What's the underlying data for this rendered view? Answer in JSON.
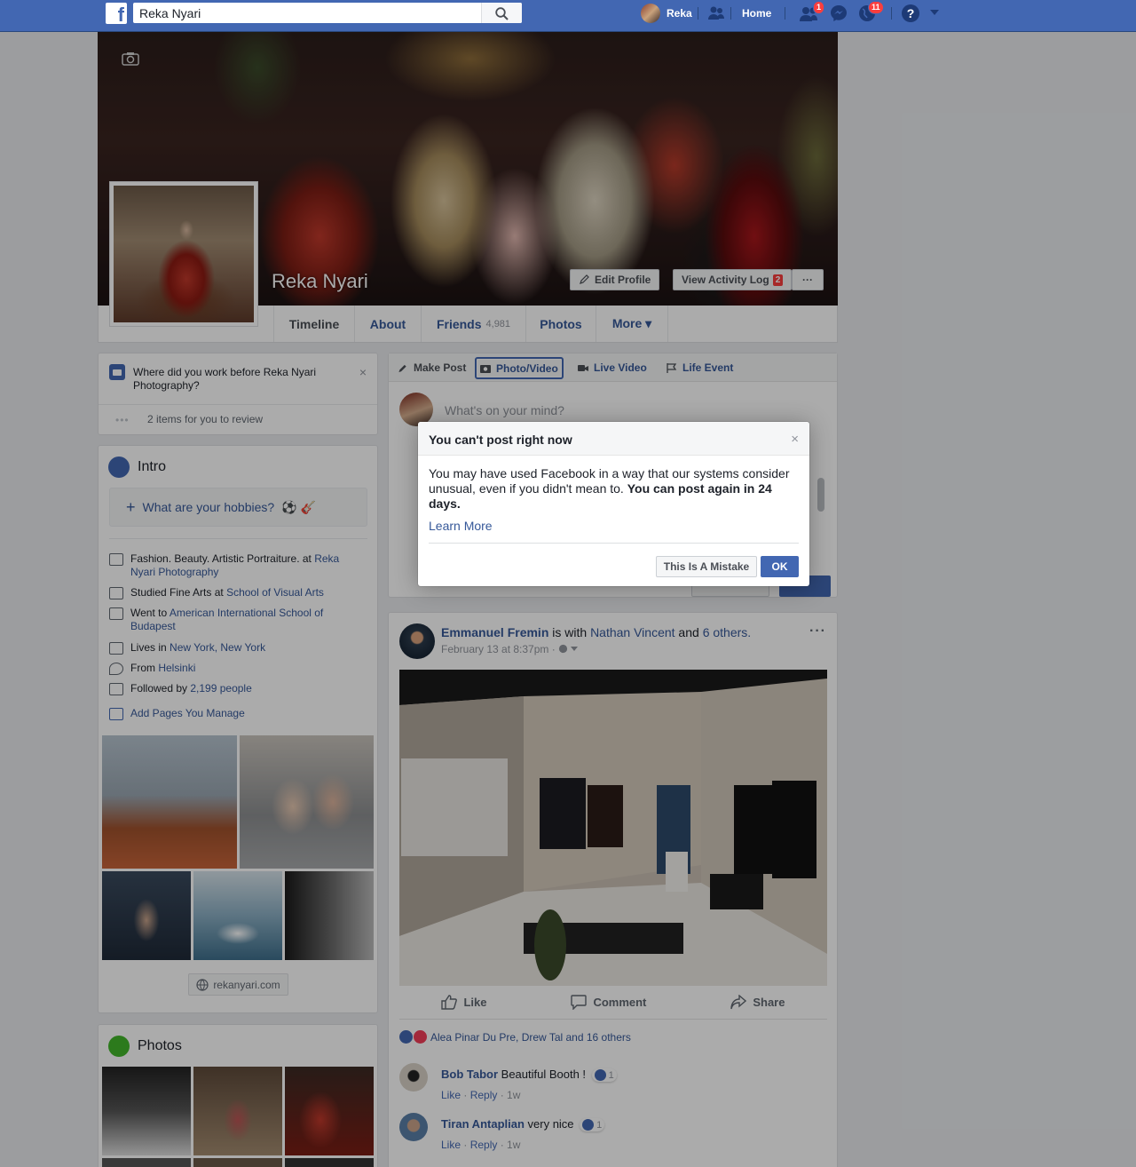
{
  "topbar": {
    "logo": "f",
    "search_value": "Reka Nyari",
    "user_name": "Reka",
    "home_label": "Home",
    "friend_requests_badge": "1",
    "notifications_badge": "11",
    "icons": [
      "search-icon",
      "friends-icon",
      "friend-requests-icon",
      "messenger-icon",
      "notifications-globe-icon",
      "help-icon",
      "account-menu-caret-icon"
    ]
  },
  "profile": {
    "name": "Reka Nyari",
    "edit_profile": "Edit Profile",
    "view_activity_log": "View Activity Log",
    "activity_badge": "2",
    "more_dots": "···"
  },
  "tabs": [
    {
      "label": "Timeline"
    },
    {
      "label": "About"
    },
    {
      "label": "Friends",
      "count": "4,981"
    },
    {
      "label": "Photos"
    },
    {
      "label": "More ▾"
    }
  ],
  "question_card": {
    "text": "Where did you work before Reka Nyari Photography?",
    "review": "2 items for you to review",
    "dots": "•••",
    "close": "×"
  },
  "intro": {
    "title": "Intro",
    "hobbies_prompt": "What are your hobbies?",
    "hobby_emojis": "⚽ 🎸",
    "items": [
      {
        "pre": "Fashion. Beauty. Artistic Portraiture. at ",
        "link": "Reka Nyari Photography",
        "icon": "work-icon"
      },
      {
        "pre": "Studied Fine Arts at ",
        "link": "School of Visual Arts",
        "icon": "education-icon"
      },
      {
        "pre": "Went to ",
        "link": "American International School of Budapest",
        "icon": "school-icon"
      },
      {
        "pre": "Lives in ",
        "link": "New York, New York",
        "icon": "home-icon"
      },
      {
        "pre": "From ",
        "link": "Helsinki",
        "icon": "location-pin-icon"
      },
      {
        "pre": "Followed by ",
        "link": "2,199 people",
        "icon": "followers-icon"
      }
    ],
    "add_pages": "Add Pages You Manage",
    "website": "rekanyari.com"
  },
  "photos_card": {
    "title": "Photos"
  },
  "composer": {
    "tabs": [
      "Make Post",
      "Photo/Video",
      "Live Video",
      "Life Event"
    ],
    "placeholder": "What's on your mind?"
  },
  "modal": {
    "title": "You can't post right now",
    "body_plain": "You may have used Facebook in a way that our systems consider unusual, even if you didn't mean to. ",
    "body_bold": "You can post again in 24 days.",
    "learn_more": "Learn More",
    "mistake_button": "This Is A Mistake",
    "ok_button": "OK",
    "close": "×"
  },
  "post": {
    "author": "Emmanuel Fremin",
    "with_text": " is with ",
    "tagged": "Nathan Vincent",
    "and_text": " and ",
    "others": "6 others.",
    "timestamp": "February 13 at 8:37pm · ",
    "more": "···",
    "like": "Like",
    "comment": "Comment",
    "share": "Share",
    "reactions_text": "Alea Pinar Du Pre, Drew Tal and 16 others",
    "comments": [
      {
        "name": "Bob Tabor",
        "text": " Beautiful Booth !",
        "reactions": "1",
        "like": "Like",
        "reply": "Reply",
        "time": " · 1w"
      },
      {
        "name": "Tiran Antaplian",
        "text": " very nice",
        "reactions": "1",
        "like": "Like",
        "reply": "Reply",
        "time": " · 1w"
      }
    ]
  },
  "colors": {
    "brand": "#4267b2",
    "link": "#365899",
    "badge": "#fa3e3e"
  }
}
